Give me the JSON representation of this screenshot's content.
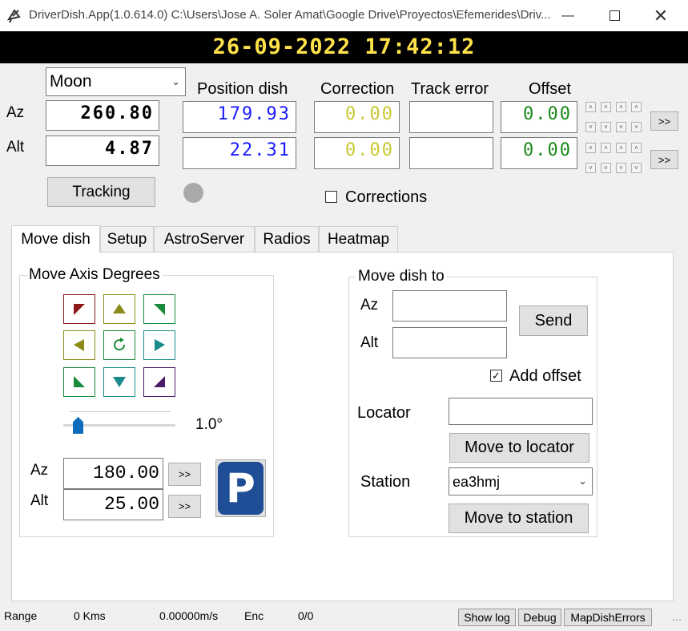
{
  "window": {
    "title": "DriverDish.App(1.0.614.0) C:\\Users\\Jose A. Soler Amat\\Google Drive\\Proyectos\\Efemerides\\Driv...",
    "minimize_icon": "minimize-icon",
    "maximize_icon": "maximize-icon",
    "close_icon": "close-icon"
  },
  "clock": "26-09-2022 17:42:12",
  "target": {
    "selected": "Moon"
  },
  "headers": {
    "position": "Position dish",
    "correction": "Correction",
    "track_error": "Track error",
    "offset": "Offset"
  },
  "labels": {
    "az": "Az",
    "alt": "Alt"
  },
  "az": {
    "target": "260.80",
    "position": "179.93",
    "correction": "0.00",
    "track_error": "",
    "offset": "0.00"
  },
  "alt": {
    "target": "4.87",
    "position": "22.31",
    "correction": "0.00",
    "track_error": "",
    "offset": "0.00"
  },
  "tracking_label": "Tracking",
  "corrections_label": "Corrections",
  "more_label": ">>",
  "tabs": [
    "Move dish",
    "Setup",
    "AstroServer",
    "Radios",
    "Heatmap"
  ],
  "move_axis": {
    "title": "Move Axis Degrees",
    "step": "1.0°",
    "step_value": 1.0,
    "az_label": "Az",
    "alt_label": "Alt",
    "az_value": "180.00",
    "alt_value": "25.00",
    "go_label": ">>",
    "park_label": "P"
  },
  "move_to": {
    "title": "Move dish to",
    "az_label": "Az",
    "alt_label": "Alt",
    "az_value": "",
    "alt_value": "",
    "send_label": "Send",
    "add_offset_label": "Add offset",
    "locator_label": "Locator",
    "locator_value": "",
    "move_locator_label": "Move to locator",
    "station_label": "Station",
    "station_value": "ea3hmj",
    "move_station_label": "Move to station"
  },
  "status": {
    "range_label": "Range",
    "range_value": "0 Kms",
    "speed_value": "0.00000m/s",
    "enc_label": "Enc",
    "enc_value": "0/0",
    "show_log": "Show log",
    "debug": "Debug",
    "map_errors": "MapDishErrors"
  },
  "colors": {
    "position": "#1a1aff",
    "correction": "#c8c832",
    "offset": "#1a8a1a",
    "clock": "#ffe24a",
    "park": "#1f4e96"
  }
}
